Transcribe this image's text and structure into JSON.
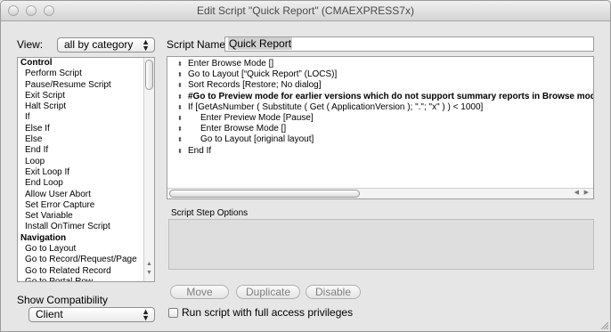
{
  "window": {
    "title": "Edit Script \"Quick Report\" (CMAEXPRESS7x)"
  },
  "view": {
    "label": "View:",
    "selected": "all by category"
  },
  "script_name": {
    "label": "Script Name:",
    "value": "Quick Report"
  },
  "steps": [
    {
      "label": "Control",
      "category": true
    },
    {
      "label": "Perform Script"
    },
    {
      "label": "Pause/Resume Script"
    },
    {
      "label": "Exit Script"
    },
    {
      "label": "Halt Script"
    },
    {
      "label": "If"
    },
    {
      "label": "Else If"
    },
    {
      "label": "Else"
    },
    {
      "label": "End If"
    },
    {
      "label": "Loop"
    },
    {
      "label": "Exit Loop If"
    },
    {
      "label": "End Loop"
    },
    {
      "label": "Allow User Abort"
    },
    {
      "label": "Set Error Capture"
    },
    {
      "label": "Set Variable"
    },
    {
      "label": "Install OnTimer Script"
    },
    {
      "label": "Navigation",
      "category": true
    },
    {
      "label": "Go to Layout"
    },
    {
      "label": "Go to Record/Request/Page"
    },
    {
      "label": "Go to Related Record"
    },
    {
      "label": "Go to Portal Row"
    }
  ],
  "script_lines": [
    {
      "text": "Enter Browse Mode []",
      "bold": false,
      "indent": 0
    },
    {
      "text": "Go to Layout [“Quick Report” (LOCS)]",
      "bold": false,
      "indent": 0
    },
    {
      "text": "Sort Records [Restore; No dialog]",
      "bold": false,
      "indent": 0
    },
    {
      "text": "#Go to Preview mode for earlier versions which do not support summary reports in Browse mode.",
      "bold": true,
      "indent": 0
    },
    {
      "text": "If [GetAsNumber ( Substitute ( Get ( ApplicationVersion ); \".\"; \"x\" ) ) < 1000]",
      "bold": false,
      "indent": 0
    },
    {
      "text": "Enter Preview Mode [Pause]",
      "bold": false,
      "indent": 1
    },
    {
      "text": "Enter Browse Mode []",
      "bold": false,
      "indent": 1
    },
    {
      "text": "Go to Layout [original layout]",
      "bold": false,
      "indent": 1
    },
    {
      "text": "End If",
      "bold": false,
      "indent": 0
    }
  ],
  "step_options": {
    "label": "Script Step Options"
  },
  "buttons": {
    "move": "Move",
    "duplicate": "Duplicate",
    "disable": "Disable"
  },
  "compatibility": {
    "label": "Show Compatibility",
    "selected": "Client"
  },
  "full_access": {
    "label": "Run script with full access privileges",
    "checked": false
  }
}
